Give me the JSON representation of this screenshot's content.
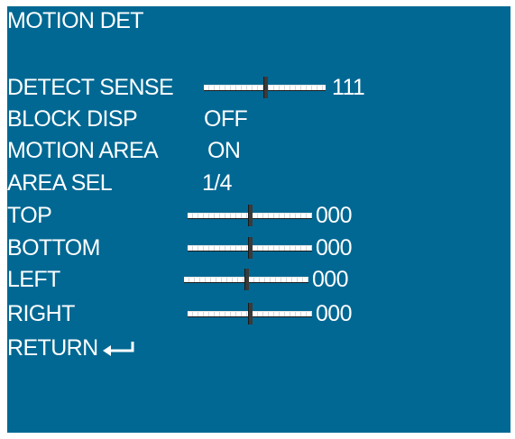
{
  "osd": {
    "title": "MOTION DET",
    "rows": {
      "detect_sense": {
        "label": "DETECT SENSE",
        "value": "111",
        "level": 0.5
      },
      "block_disp": {
        "label": "BLOCK DISP",
        "value": "OFF"
      },
      "motion_area": {
        "label": "MOTION AREA",
        "value": "ON"
      },
      "area_sel": {
        "label": "AREA SEL",
        "value": "1/4"
      },
      "top": {
        "label": "TOP",
        "value": "000",
        "level": 0.5
      },
      "bottom": {
        "label": "BOTTOM",
        "value": "000",
        "level": 0.5
      },
      "left": {
        "label": "LEFT",
        "value": "000",
        "level": 0.5
      },
      "right": {
        "label": "RIGHT",
        "value": "000",
        "level": 0.5
      },
      "return": {
        "label": "RETURN",
        "icon": "return-arrow-icon"
      }
    },
    "colors": {
      "background": "#006893",
      "text": "#ffffff"
    }
  }
}
